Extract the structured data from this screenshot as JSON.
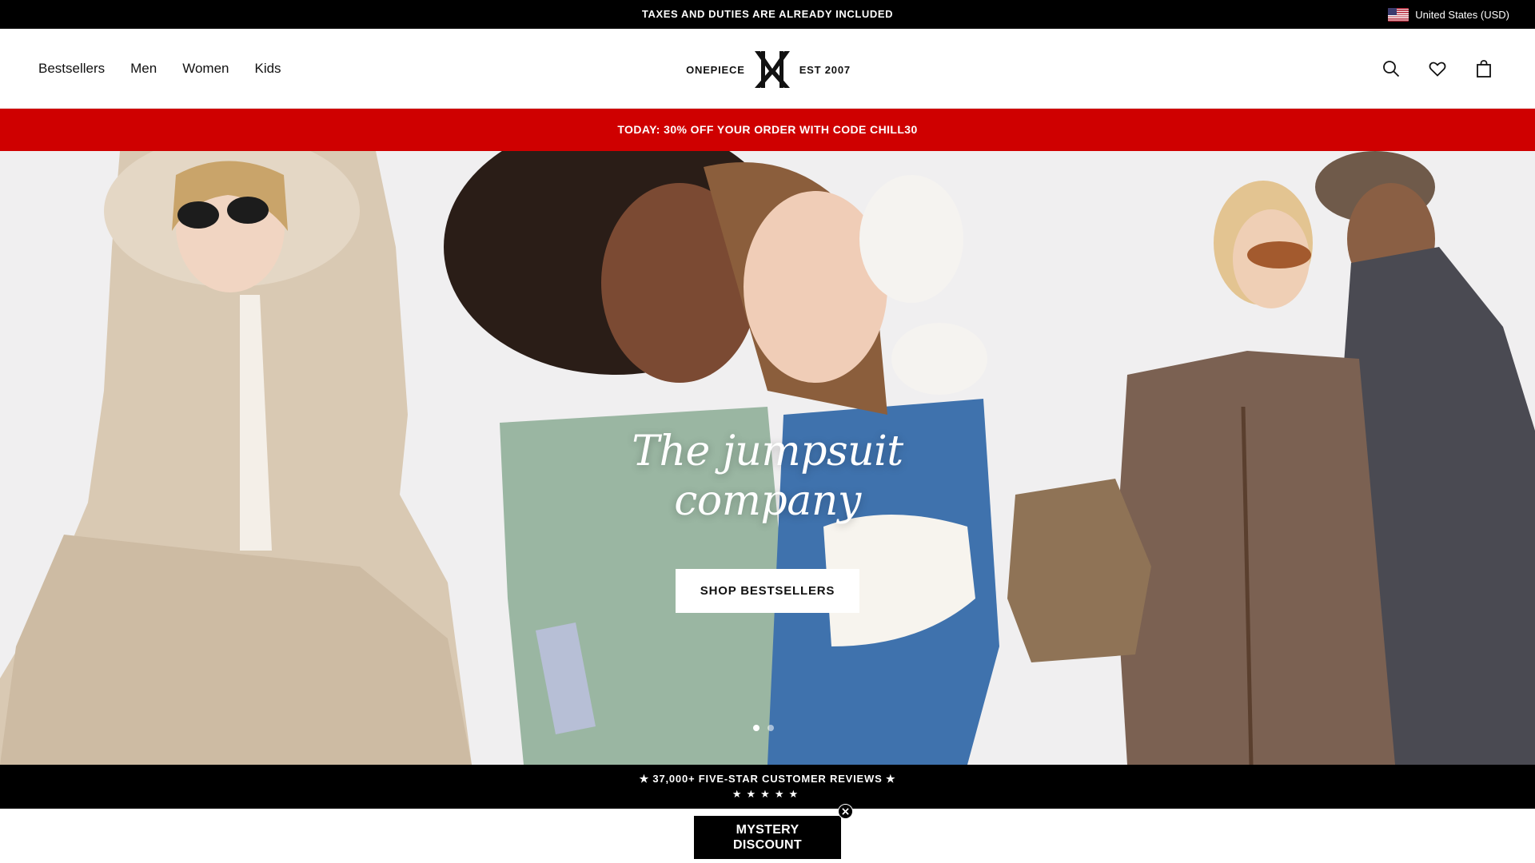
{
  "announcement": {
    "text": "TAXES AND DUTIES ARE ALREADY INCLUDED",
    "region_label": "United States (USD)"
  },
  "header": {
    "nav": [
      "Bestsellers",
      "Men",
      "Women",
      "Kids"
    ],
    "logo_left": "ONEPIECE",
    "logo_right": "EST  2007",
    "icons": [
      "search-icon",
      "heart-icon",
      "shopping-bag-icon"
    ]
  },
  "promo": {
    "text": "TODAY: 30% OFF YOUR ORDER WITH CODE CHILL30"
  },
  "hero": {
    "title_line1": "The jumpsuit",
    "title_line2": "company",
    "cta_label": "SHOP BESTSELLERS",
    "slide_count": 2,
    "active_slide": 1
  },
  "reviews": {
    "text": "★ 37,000+ FIVE-STAR CUSTOMER REVIEWS ★",
    "stars": "★★★★★"
  },
  "mystery": {
    "line1": "MYSTERY",
    "line2": "DISCOUNT"
  },
  "colors": {
    "promo_red": "#cf0000",
    "bar_black": "#000000",
    "hero_background": "#f0eff0"
  }
}
